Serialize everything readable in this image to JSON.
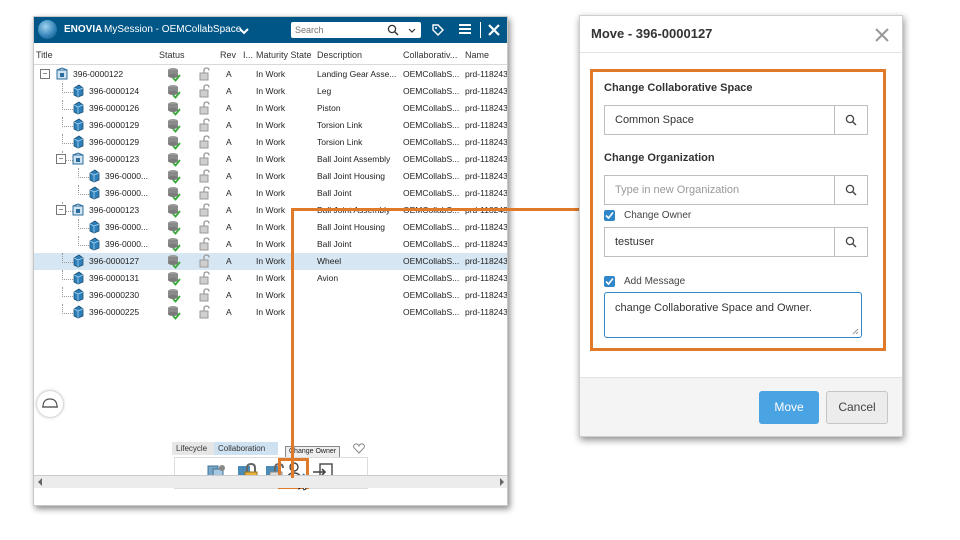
{
  "enovia": {
    "brand": "ENOVIA",
    "session": "MySession - OEMCollabSpace",
    "search_placeholder": "Search"
  },
  "columns": {
    "title": "Title",
    "status": "Status",
    "i": "I...",
    "rev": "Rev",
    "maturity": "Maturity State",
    "description": "Description",
    "collab": "Collaborativ...",
    "name": "Name"
  },
  "rows": [
    {
      "title": "396-0000122",
      "rev": "A",
      "state": "In Work",
      "desc": "Landing Gear Asse...",
      "collab": "OEMCollabS...",
      "name": "prd-118243"
    },
    {
      "title": "396-0000124",
      "rev": "A",
      "state": "In Work",
      "desc": "Leg",
      "collab": "OEMCollabS...",
      "name": "prd-118243"
    },
    {
      "title": "396-0000126",
      "rev": "A",
      "state": "In Work",
      "desc": "Piston",
      "collab": "OEMCollabS...",
      "name": "prd-118243"
    },
    {
      "title": "396-0000129",
      "rev": "A",
      "state": "In Work",
      "desc": "Torsion Link",
      "collab": "OEMCollabS...",
      "name": "prd-118243"
    },
    {
      "title": "396-0000129",
      "rev": "A",
      "state": "In Work",
      "desc": "Torsion Link",
      "collab": "OEMCollabS...",
      "name": "prd-118243"
    },
    {
      "title": "396-0000123",
      "rev": "A",
      "state": "In Work",
      "desc": "Ball Joint Assembly",
      "collab": "OEMCollabS...",
      "name": "prd-118243"
    },
    {
      "title": "396-0000...",
      "rev": "A",
      "state": "In Work",
      "desc": "Ball Joint Housing",
      "collab": "OEMCollabS...",
      "name": "prd-118243"
    },
    {
      "title": "396-0000...",
      "rev": "A",
      "state": "In Work",
      "desc": "Ball Joint",
      "collab": "OEMCollabS...",
      "name": "prd-118243"
    },
    {
      "title": "396-0000123",
      "rev": "A",
      "state": "In Work",
      "desc": "Ball Joint Assembly",
      "collab": "OEMCollabS...",
      "name": "prd-118243"
    },
    {
      "title": "396-0000...",
      "rev": "A",
      "state": "In Work",
      "desc": "Ball Joint Housing",
      "collab": "OEMCollabS...",
      "name": "prd-118243"
    },
    {
      "title": "396-0000...",
      "rev": "A",
      "state": "In Work",
      "desc": "Ball Joint",
      "collab": "OEMCollabS...",
      "name": "prd-118243"
    },
    {
      "title": "396-0000127",
      "rev": "A",
      "state": "In Work",
      "desc": "Wheel",
      "collab": "OEMCollabS...",
      "name": "prd-118243"
    },
    {
      "title": "396-0000131",
      "rev": "A",
      "state": "In Work",
      "desc": "Avion",
      "collab": "OEMCollabS...",
      "name": "prd-118243"
    },
    {
      "title": "396-0000230",
      "rev": "A",
      "state": "In Work",
      "desc": "",
      "collab": "OEMCollabS...",
      "name": "prd-118243"
    },
    {
      "title": "396-0000225",
      "rev": "A",
      "state": "In Work",
      "desc": "",
      "collab": "OEMCollabS...",
      "name": "prd-118243"
    }
  ],
  "actionbar": {
    "tab_lifecycle": "Lifecycle",
    "tab_collaboration": "Collaboration",
    "tooltip": "Change Owner"
  },
  "dialog": {
    "title": "Move - 396-0000127",
    "collab_label": "Change Collaborative Space",
    "collab_value": "Common Space",
    "org_label": "Change Organization",
    "org_placeholder": "Type in new Organization",
    "owner_check_label": "Change Owner",
    "owner_value": "testuser",
    "message_check_label": "Add Message",
    "message_value": "change Collaborative Space and Owner.",
    "move_button": "Move",
    "cancel_button": "Cancel"
  },
  "colors": {
    "header": "#005686",
    "highlight": "#e07a28",
    "selected_row": "#d6e6f3",
    "primary_button": "#4aa3e2"
  }
}
